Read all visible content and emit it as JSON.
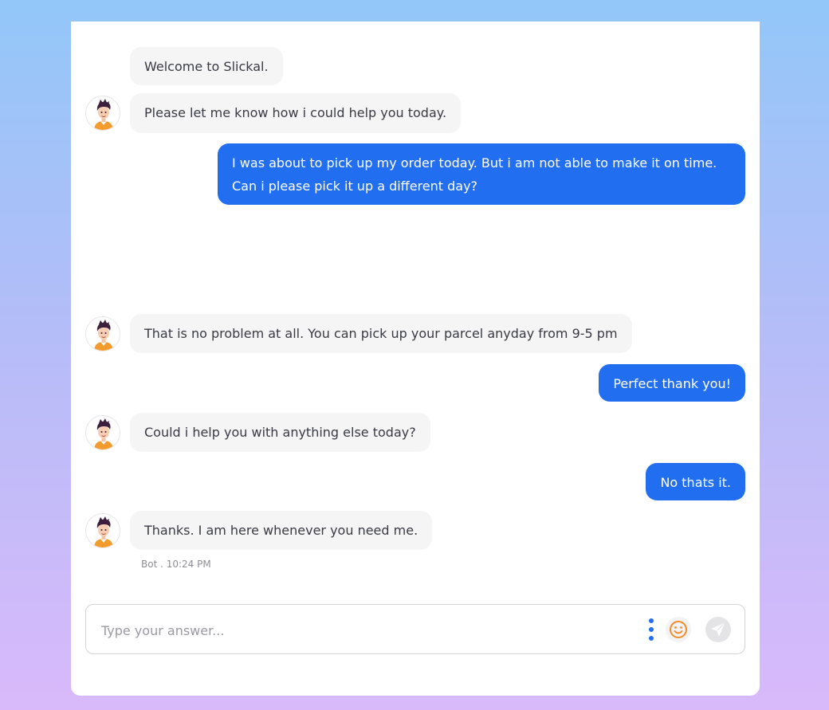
{
  "colors": {
    "accent": "#226ef0",
    "bot_bubble": "#f5f5f6",
    "emoji": "#f28c28"
  },
  "messages": [
    {
      "sender": "bot",
      "text": "Welcome to Slickal."
    },
    {
      "sender": "bot",
      "text": "Please let me know how i could help you today."
    },
    {
      "sender": "user",
      "lines": [
        "I was about to pick up my order today. But i am not able to make it on time.",
        "Can i please pick it up a different day?"
      ]
    },
    {
      "sender": "bot",
      "text": "That is no problem at all. You can pick up your parcel anyday from 9-5 pm"
    },
    {
      "sender": "user",
      "text": "Perfect thank you!"
    },
    {
      "sender": "bot",
      "text": "Could i help you with anything else today?"
    },
    {
      "sender": "user",
      "text": "No thats it."
    },
    {
      "sender": "bot",
      "text": "Thanks. I am here whenever you need me."
    }
  ],
  "last_message_meta": "Bot . 10:24 PM",
  "composer": {
    "placeholder": "Type your answer...",
    "icons": {
      "more": "more-vertical-icon",
      "emoji": "smiley-icon",
      "send": "send-icon"
    }
  }
}
